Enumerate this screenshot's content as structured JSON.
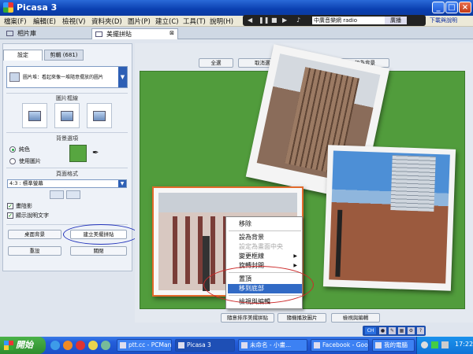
{
  "window": {
    "title": "Picasa 3"
  },
  "menu": [
    "檔案(F)",
    "編輯(E)",
    "檢視(V)",
    "資料夾(D)",
    "圖片(P)",
    "建立(C)",
    "工具(T)",
    "說明(H)"
  ],
  "media_player": {
    "station": "中廣音樂網 radio",
    "button": "廣播"
  },
  "download_link": "下載與說明",
  "tabs": {
    "library": "相片庫",
    "collage": "美擺拼貼"
  },
  "left_panel": {
    "tab_settings": "設定",
    "tab_clips": "剪輯 (681)",
    "selector_text": "圖片堆：看起來像一堆隨意擺放的圖片",
    "border_label": "圖片框線",
    "bg_label": "背景選項",
    "bg_solid": "純色",
    "bg_image": "使用圖片",
    "bg_color": "#57a640",
    "format_label": "頁面格式",
    "format_value": "4:3 : 標準螢幕",
    "shadow_label": "畫陰影",
    "caption_label": "顯示說明文字",
    "btn_desktop": "桌面背景",
    "btn_create": "建立美擺拼貼",
    "btn_reset": "重設",
    "btn_close": "關閉"
  },
  "top_buttons": [
    "全選",
    "取消選取",
    "移除",
    "設為背景"
  ],
  "context_menu": [
    {
      "label": "移除",
      "state": "normal"
    },
    {
      "label": "設為背景",
      "state": "normal"
    },
    {
      "label": "設定為畫面中央",
      "state": "disabled"
    },
    {
      "label": "變更框線",
      "state": "submenu"
    },
    {
      "label": "旋轉封閉",
      "state": "submenu"
    },
    {
      "label": "置頂",
      "state": "normal"
    },
    {
      "label": "移到底部",
      "state": "highlighted"
    },
    {
      "label": "檢視與編輯",
      "state": "normal"
    }
  ],
  "bottom_buttons": [
    "隨意排序美擺拼貼",
    "隨機播放圖片",
    "檢視與編輯"
  ],
  "taskbar": {
    "start": "開始",
    "tasks": [
      "ptt.cc - PCMan ...",
      "Picasa 3",
      "未命名 - 小畫...",
      "Facebook - Goo...",
      "我的電腦"
    ],
    "lang": "CH",
    "clock": "17:22"
  }
}
